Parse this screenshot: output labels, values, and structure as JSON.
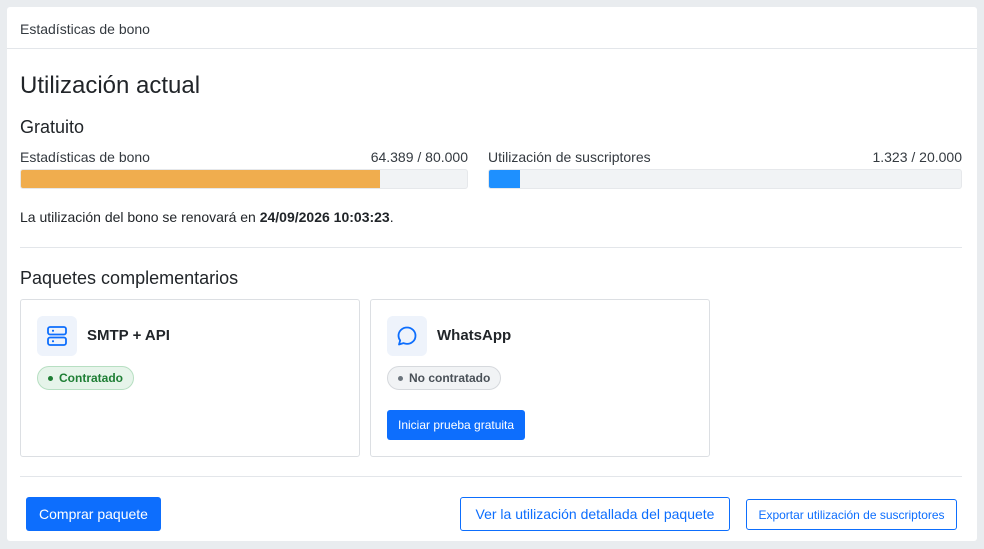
{
  "header": {
    "title": "Estadísticas de bono"
  },
  "main": {
    "title": "Utilización actual",
    "plan": "Gratuito",
    "meters": [
      {
        "label": "Estadísticas de bono",
        "value": "64.389 / 80.000",
        "fraction": 0.8049,
        "color": "#f0ad4e"
      },
      {
        "label": "Utilización de suscriptores",
        "value": "1.323 / 20.000",
        "fraction": 0.066,
        "color": "#1e90ff"
      }
    ],
    "renew": {
      "prefix": "La utilización del bono se renovará en ",
      "date": "24/09/2026 10:03:23",
      "suffix": "."
    }
  },
  "addons": {
    "title": "Paquetes complementarios",
    "items": [
      {
        "name": "SMTP + API",
        "icon": "server-icon",
        "status": "Contratado",
        "status_color": "#28a745"
      },
      {
        "name": "WhatsApp",
        "icon": "chat-bubble-icon",
        "status": "No contratado",
        "status_color": "#6c757d",
        "action": "Iniciar prueba gratuita"
      }
    ]
  },
  "footer": {
    "buy": "Comprar paquete",
    "detailed": "Ver la utilización detallada del paquete",
    "export": "Exportar utilización de suscriptores"
  }
}
